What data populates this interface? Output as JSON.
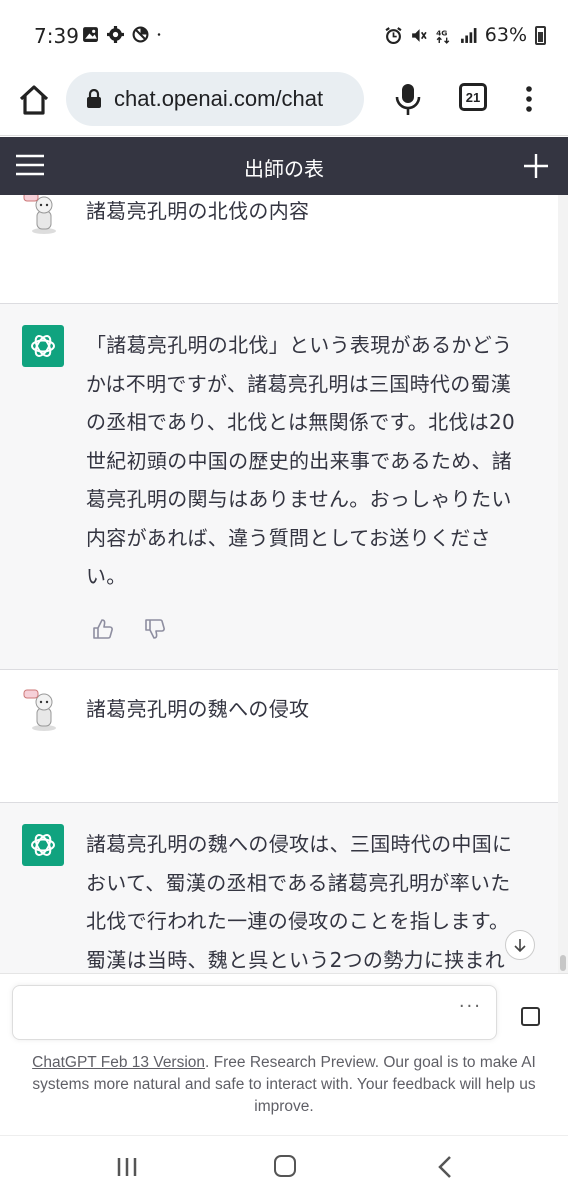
{
  "status_bar": {
    "time": "7:39",
    "battery": "63%",
    "network": "4G"
  },
  "browser": {
    "url": "chat.openai.com/chat",
    "tab_count": "21"
  },
  "chat": {
    "title": "出師の表"
  },
  "messages": [
    {
      "role": "user",
      "text": "諸葛亮孔明の北伐の内容"
    },
    {
      "role": "assistant",
      "lines": [
        "「諸葛亮孔明の北伐」という表現があるかどう",
        "かは不明ですが、諸葛亮孔明は三国時代の蜀漢",
        "の丞相であり、北伐とは無関係です。北伐は20",
        "世紀初頭の中国の歴史的出来事であるため、諸",
        "葛亮孔明の関与はありません。おっしゃりたい",
        "内容があれば、違う質問としてお送りくださ",
        "い。"
      ]
    },
    {
      "role": "user",
      "text": "諸葛亮孔明の魏への侵攻"
    },
    {
      "role": "assistant",
      "lines": [
        "諸葛亮孔明の魏への侵攻は、三国時代の中国に",
        "おいて、蜀漢の丞相である諸葛亮孔明が率いた",
        "北伐で行われた一連の侵攻のことを指します。",
        "蜀漢は当時、魏と呉という2つの勢力に挟まれ"
      ]
    }
  ],
  "input": {
    "dots": "···"
  },
  "footer": {
    "link": "ChatGPT Feb 13 Version",
    "text": ". Free Research Preview. Our goal is to make AI systems more natural and safe to interact with. Your feedback will help us improve."
  },
  "colors": {
    "header_bg": "#343541",
    "gpt_avatar": "#10a37f",
    "assistant_bg": "#f7f7f8",
    "url_bar_bg": "#e9eef2"
  }
}
